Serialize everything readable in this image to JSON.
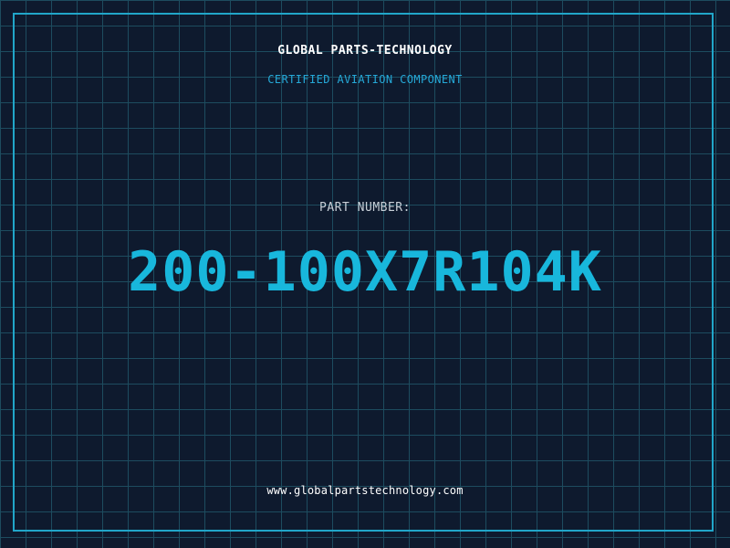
{
  "header": {
    "company": "GLOBAL PARTS-TECHNOLOGY",
    "tagline": "CERTIFIED AVIATION COMPONENT"
  },
  "part": {
    "label": "PART NUMBER:",
    "number": "200-100X7R104K"
  },
  "footer": {
    "website": "www.globalpartstechnology.com"
  },
  "colors": {
    "background": "#0e1a2e",
    "grid": "#1d4c5f",
    "accent": "#18b7dc",
    "frame": "#21a6c9"
  }
}
